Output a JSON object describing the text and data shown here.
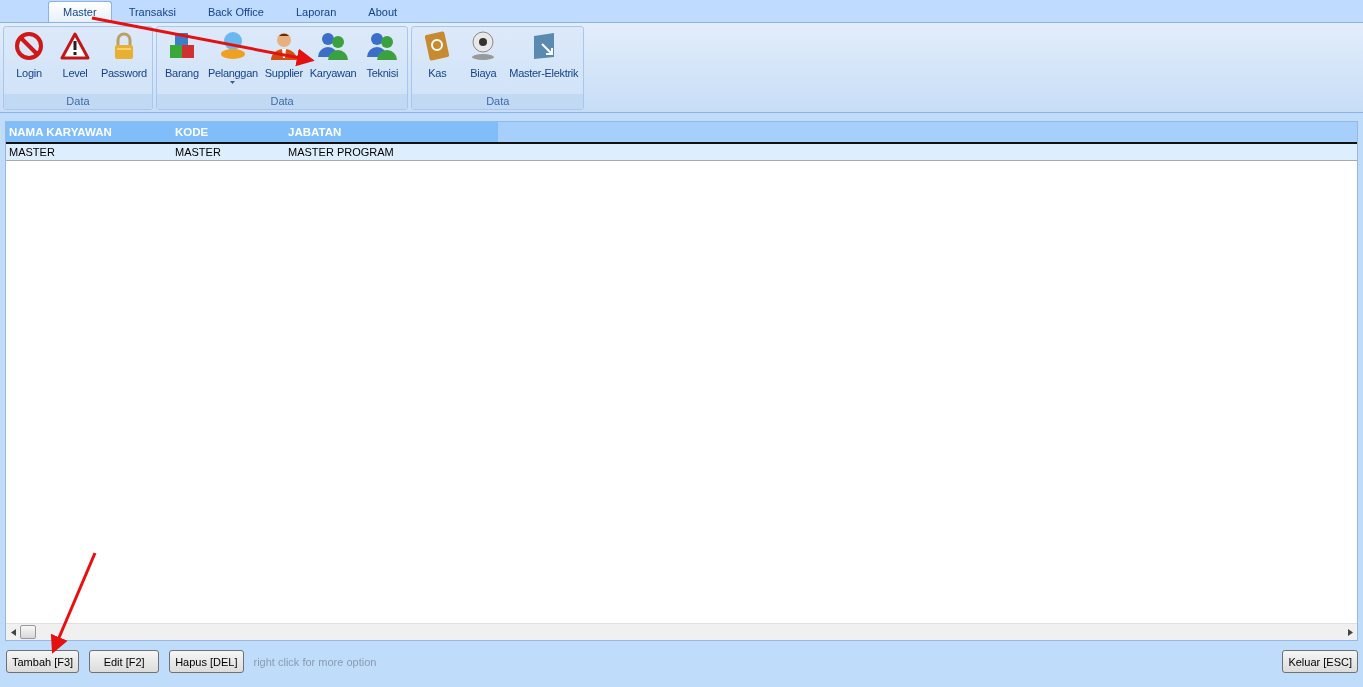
{
  "tabs": [
    {
      "label": "Master",
      "selected": true
    },
    {
      "label": "Transaksi",
      "selected": false
    },
    {
      "label": "Back Office",
      "selected": false
    },
    {
      "label": "Laporan",
      "selected": false
    },
    {
      "label": "About",
      "selected": false
    }
  ],
  "ribbon_groups": [
    {
      "label": "Data",
      "buttons": [
        {
          "label": "Login",
          "kind": "prohibited"
        },
        {
          "label": "Level",
          "kind": "warning"
        },
        {
          "label": "Password",
          "kind": "padlock"
        }
      ]
    },
    {
      "label": "Data",
      "buttons": [
        {
          "label": "Barang",
          "kind": "cubes"
        },
        {
          "label": "Pelanggan",
          "kind": "globe",
          "dropdown": true
        },
        {
          "label": "Supplier",
          "kind": "person"
        },
        {
          "label": "Karyawan",
          "kind": "people"
        },
        {
          "label": "Teknisi",
          "kind": "people"
        }
      ]
    },
    {
      "label": "Data",
      "buttons": [
        {
          "label": "Kas",
          "kind": "book"
        },
        {
          "label": "Biaya",
          "kind": "webcam"
        },
        {
          "label": "Master-Elektrik",
          "kind": "panel"
        }
      ]
    }
  ],
  "table": {
    "columns": [
      "NAMA KARYAWAN",
      "KODE",
      "JABATAN"
    ],
    "rows": [
      {
        "cells": [
          "MASTER",
          "MASTER",
          "MASTER PROGRAM"
        ],
        "selected": false
      }
    ]
  },
  "buttons": [
    "Tambah [F3]",
    "Edit [F2]",
    "Hapus [DEL]"
  ],
  "hint": "right click for more option",
  "exit_button": "Keluar [ESC]"
}
